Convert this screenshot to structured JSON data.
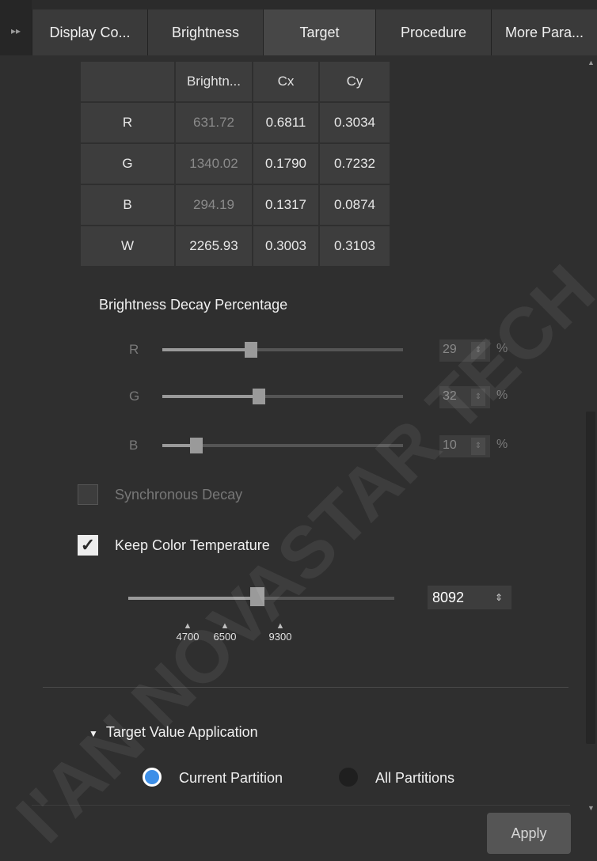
{
  "tabs": {
    "expand_icon": "double-chevron-right-icon",
    "items": [
      {
        "label": "Display Co..."
      },
      {
        "label": "Brightness"
      },
      {
        "label": "Target"
      },
      {
        "label": "Procedure"
      },
      {
        "label": "More Para..."
      }
    ],
    "active": "Target"
  },
  "target_table": {
    "headers": [
      "",
      "Brightn...",
      "Cx",
      "Cy"
    ],
    "rows": [
      {
        "label": "R",
        "brightness": "631.72",
        "cx": "0.6811",
        "cy": "0.3034"
      },
      {
        "label": "G",
        "brightness": "1340.02",
        "cx": "0.1790",
        "cy": "0.7232"
      },
      {
        "label": "B",
        "brightness": "294.19",
        "cx": "0.1317",
        "cy": "0.0874"
      },
      {
        "label": "W",
        "brightness": "2265.93",
        "cx": "0.3003",
        "cy": "0.3103"
      }
    ]
  },
  "decay": {
    "title": "Brightness Decay Percentage",
    "unit": "%",
    "channels": [
      {
        "label": "R",
        "value": "29",
        "level": 0.37
      },
      {
        "label": "G",
        "value": "32",
        "level": 0.4
      },
      {
        "label": "B",
        "value": "10",
        "level": 0.14
      }
    ]
  },
  "sync_decay": {
    "label": "Synchronous Decay",
    "checked": false
  },
  "keep_color_temp": {
    "label": "Keep Color Temperature",
    "checked": true,
    "check_glyph": "✓"
  },
  "color_temp": {
    "value": "8092",
    "markers": [
      "4700",
      "6500",
      "9300"
    ]
  },
  "target_value": {
    "title": "Target Value Application",
    "toggle_icon": "triangle-down-icon",
    "options": [
      {
        "label": "Current Partition",
        "selected": true
      },
      {
        "label": "All Partitions",
        "selected": false
      }
    ]
  },
  "apply_label": "Apply",
  "watermark": "I'AN NOVASTAR TECH"
}
